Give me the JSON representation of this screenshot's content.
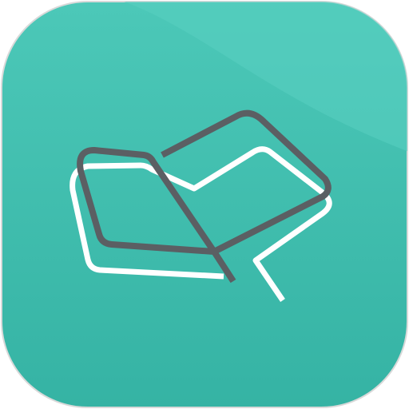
{
  "app_icon": {
    "icon": "book-map-outline-icon",
    "colors": {
      "background_top": "#4cc8b8",
      "background_bottom": "#35b3a4",
      "sheen": "#5ad0c1",
      "border": "#d9d9d9",
      "outline_dark": "#5b5f63",
      "outline_light": "#ffffff"
    }
  }
}
